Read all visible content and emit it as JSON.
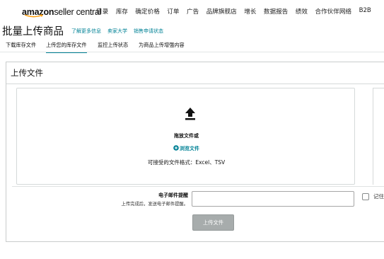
{
  "header": {
    "logo_brand": "amazon",
    "logo_product": "seller central",
    "nav": [
      "目录",
      "库存",
      "确定价格",
      "订单",
      "广告",
      "品牌旗舰店",
      "增长",
      "数据报告",
      "绩效",
      "合作伙伴网络",
      "B2B"
    ]
  },
  "page": {
    "title": "批量上传商品",
    "links": [
      "了解更多信息",
      "卖家大学",
      "销售申请状态"
    ]
  },
  "tabs": [
    {
      "label": "下载库存文件",
      "active": false
    },
    {
      "label": "上传您的库存文件",
      "active": true
    },
    {
      "label": "监控上传状态",
      "active": false
    },
    {
      "label": "为商品上传增强内容",
      "active": false
    }
  ],
  "upload": {
    "section_title": "上传文件",
    "icon": "upload-arrow-icon",
    "drop_text": "拖放文件或",
    "browse_label": "浏览文件",
    "browse_icon": "plus-circle-icon",
    "formats_text": "可接受的文件格式：Excel、TSV"
  },
  "notify": {
    "label": "电子邮件提醒",
    "sublabel": "上传完成后，发送电子邮件提醒。",
    "email_value": "",
    "remember_label": "记住",
    "remember_checked": false
  },
  "actions": {
    "upload_button": "上传文件"
  },
  "colors": {
    "link": "#008296",
    "button_disabled": "#a7acac"
  }
}
